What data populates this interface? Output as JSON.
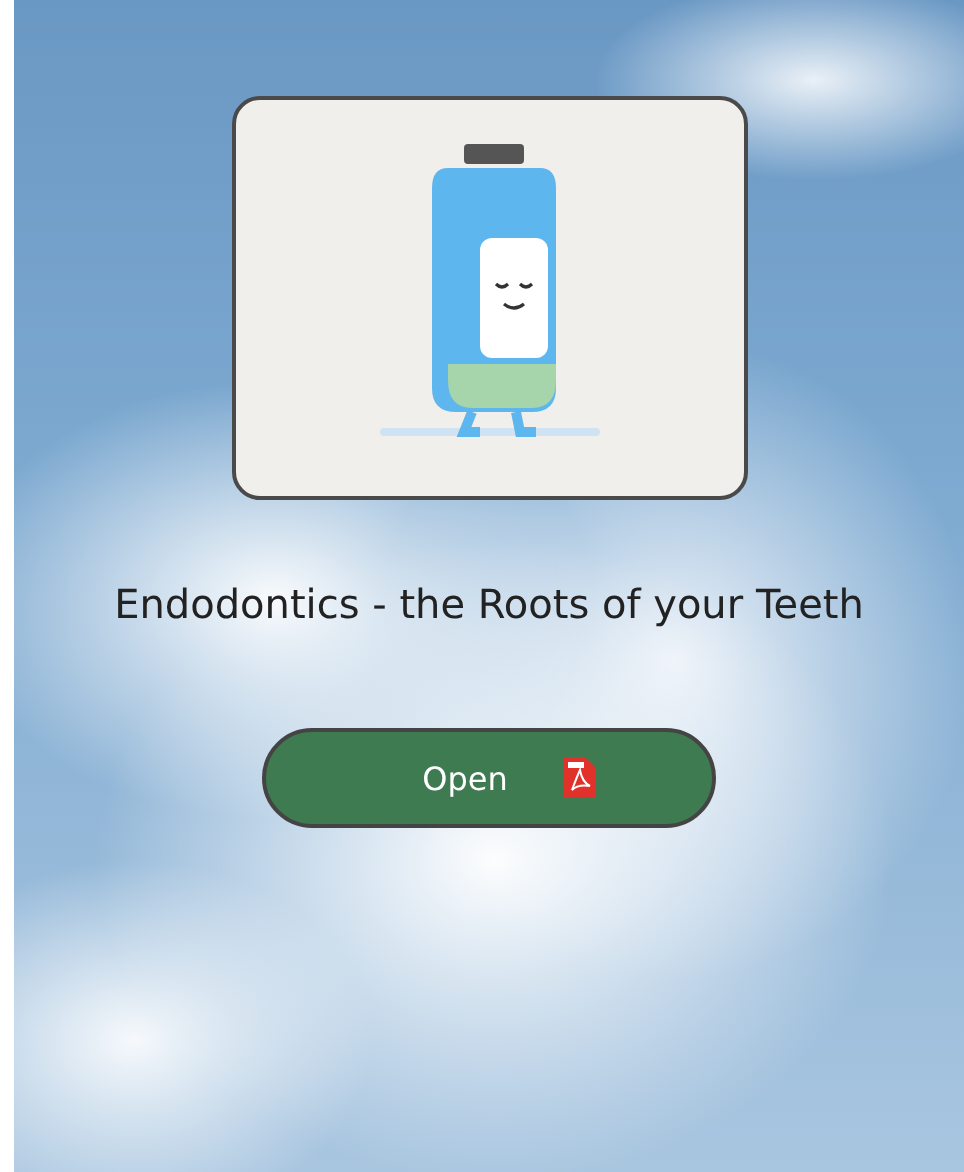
{
  "resource": {
    "title": "Endodontics - the Roots of your Teeth",
    "button": {
      "label": "Open"
    }
  }
}
